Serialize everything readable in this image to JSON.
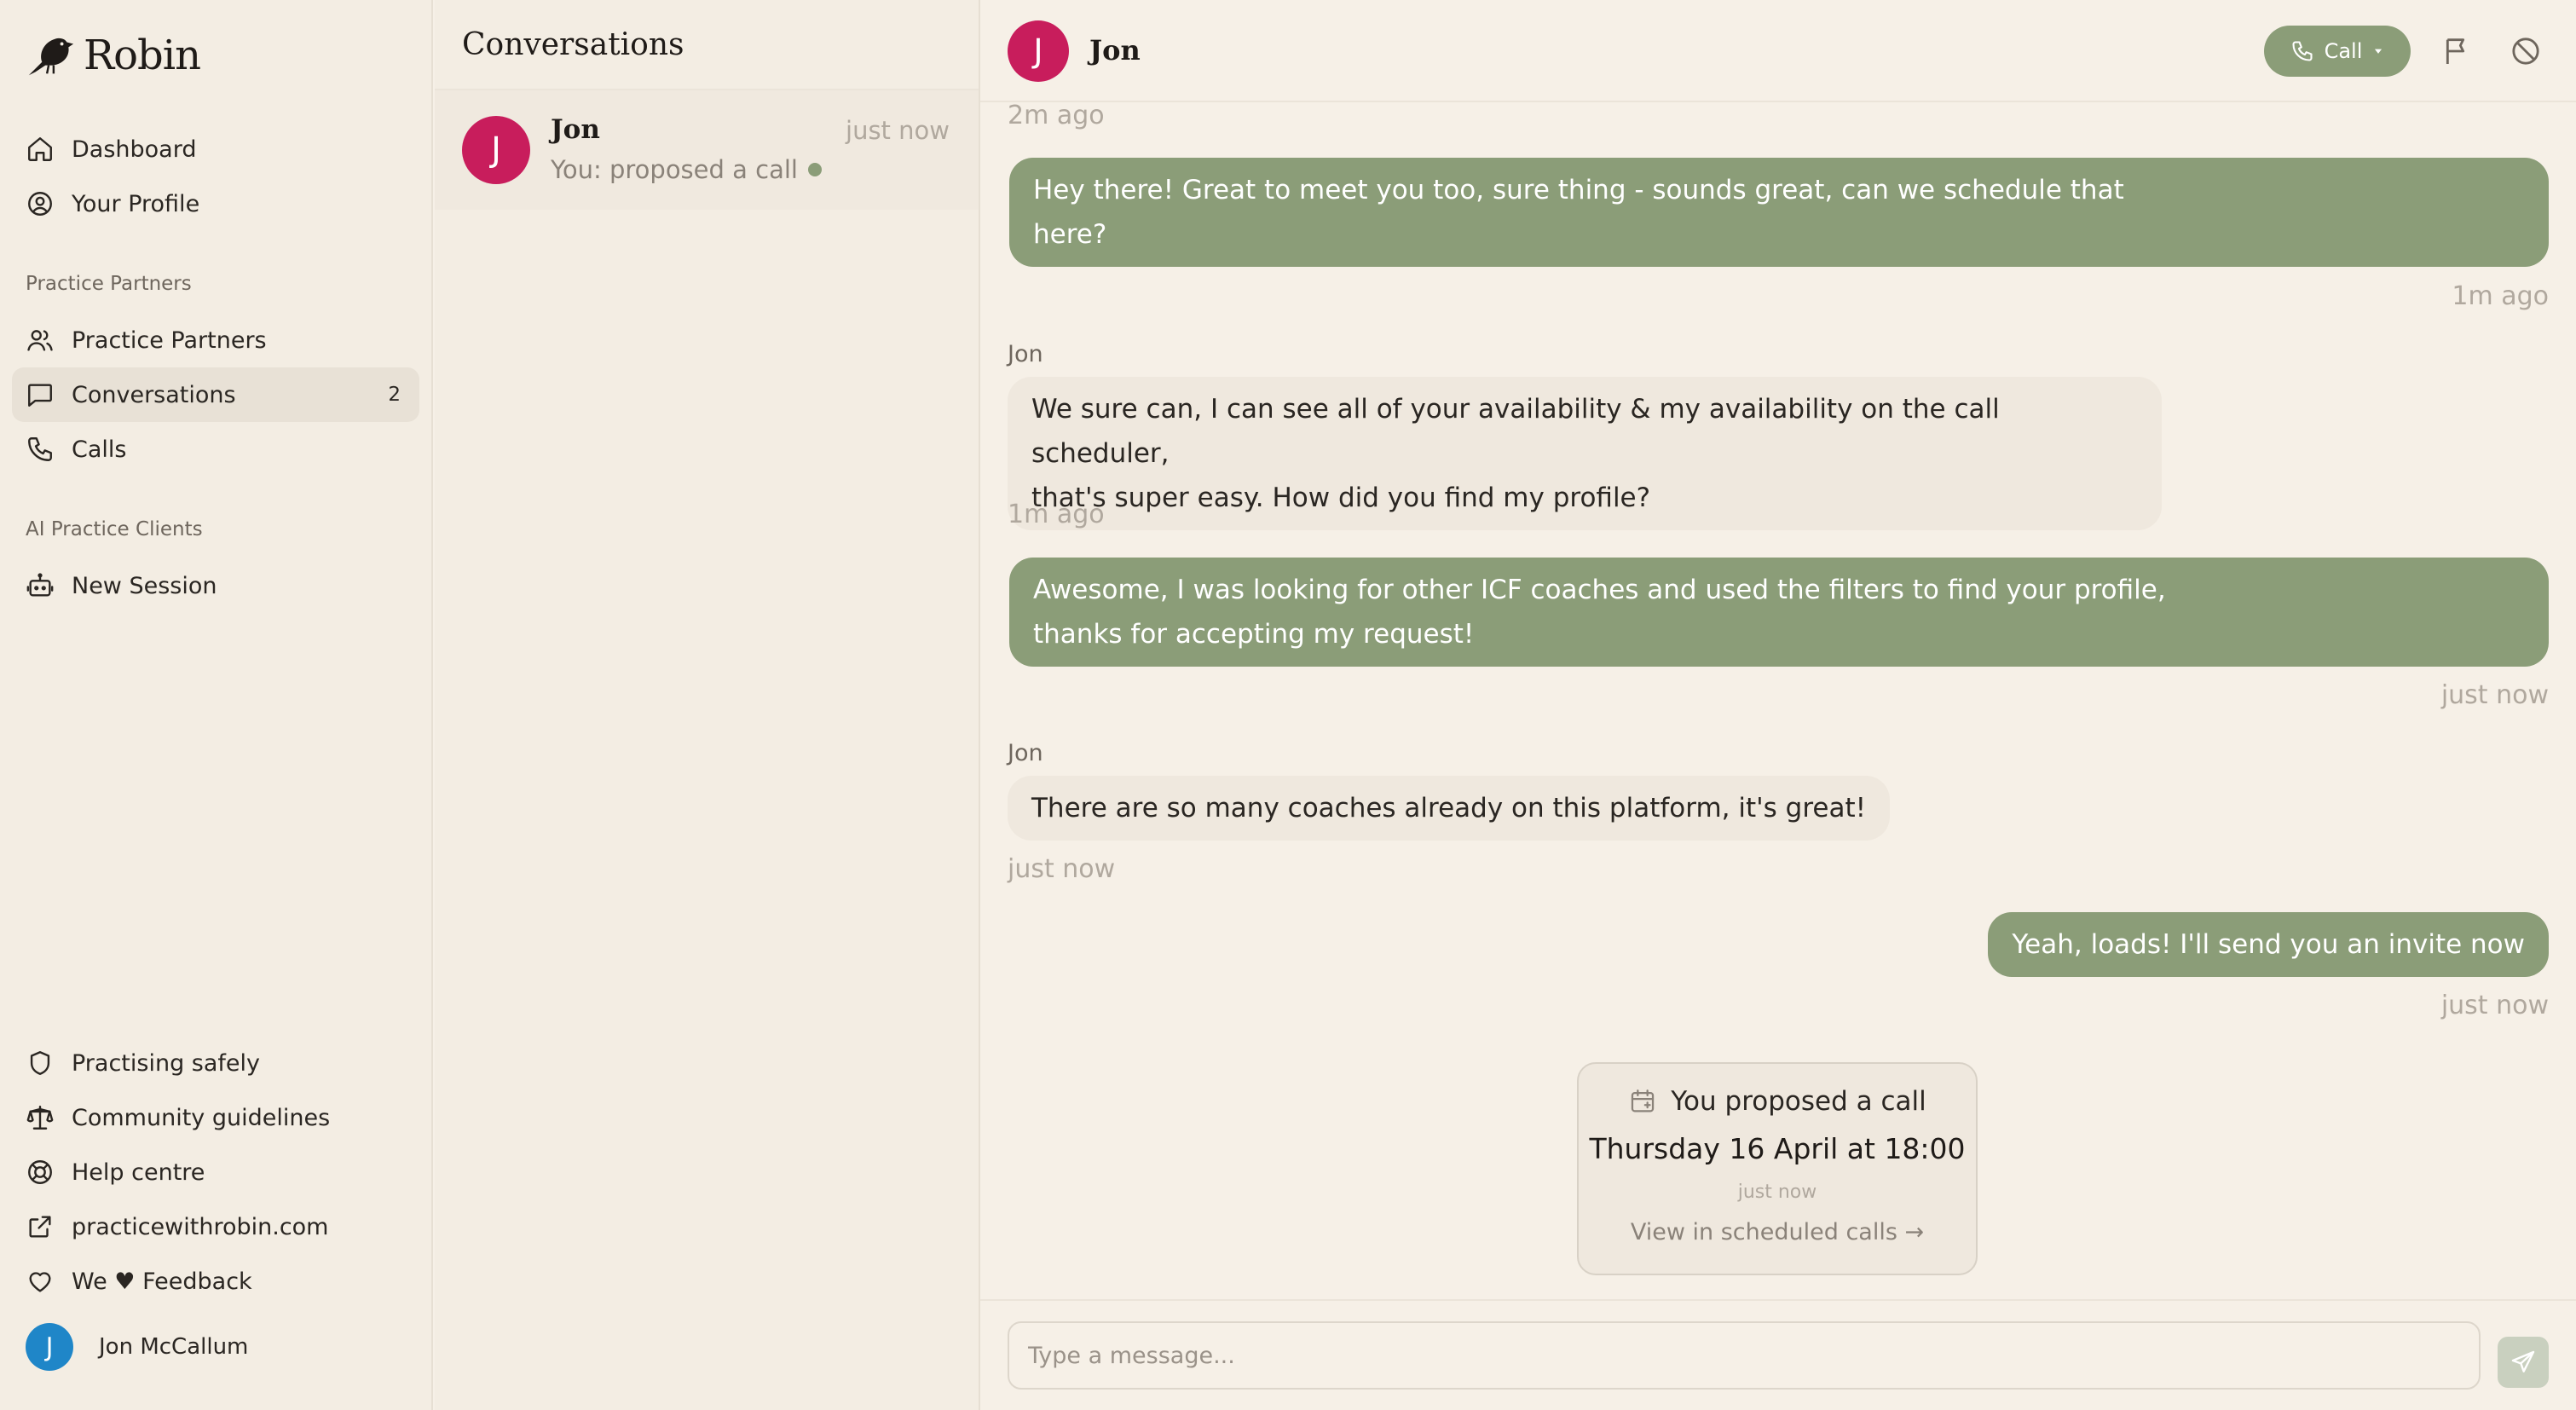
{
  "app": {
    "name": "Robin"
  },
  "sidebar": {
    "main_items": [
      {
        "label": "Dashboard",
        "icon": "home-icon"
      },
      {
        "label": "Your Profile",
        "icon": "user-circle-icon"
      }
    ],
    "section_partners": "Practice Partners",
    "partner_items": [
      {
        "label": "Practice Partners",
        "icon": "users-icon"
      },
      {
        "label": "Conversations",
        "icon": "message-square-icon",
        "count": "2",
        "active": true
      },
      {
        "label": "Calls",
        "icon": "phone-icon"
      }
    ],
    "section_ai": "AI Practice Clients",
    "ai_items": [
      {
        "label": "New Session",
        "icon": "bot-icon"
      }
    ],
    "footer_items": [
      {
        "label": "Practising safely",
        "icon": "shield-icon"
      },
      {
        "label": "Community guidelines",
        "icon": "scale-icon"
      },
      {
        "label": "Help centre",
        "icon": "lifebuoy-icon"
      },
      {
        "label": "practicewithrobin.com",
        "icon": "external-link-icon"
      },
      {
        "label": "We ♥ Feedback",
        "icon": "heart-icon"
      }
    ],
    "user": {
      "initial": "J",
      "name": "Jon McCallum",
      "avatar_color": "#1f86c8"
    }
  },
  "conversations": {
    "title": "Conversations",
    "items": [
      {
        "initial": "J",
        "name": "Jon",
        "time": "just now",
        "preview": "You: proposed a call",
        "unread": true,
        "avatar_color": "#c81d5c"
      }
    ]
  },
  "chat": {
    "contact": {
      "initial": "J",
      "name": "Jon"
    },
    "call_button": "Call",
    "header_icons": [
      "flag-icon",
      "block-icon"
    ],
    "top_timestamp": "2m ago",
    "messages": [
      {
        "from": "me",
        "lines": [
          "Hey there! Great to meet you too, sure thing - sounds great, can we schedule that",
          "here?"
        ],
        "time": "1m ago"
      },
      {
        "from": "them",
        "sender": "Jon",
        "lines": [
          "We sure can, I can see all of your availability & my availability on the call scheduler,",
          "that's super easy. How did you find my profile?"
        ],
        "time": "1m ago"
      },
      {
        "from": "me",
        "lines": [
          "Awesome, I was looking for other ICF coaches and used the filters to find your profile,",
          "thanks for accepting my request!"
        ],
        "time": "just now"
      },
      {
        "from": "them",
        "sender": "Jon",
        "lines": [
          "There are so many coaches already on this platform, it's great!"
        ],
        "time": "just now"
      },
      {
        "from": "me",
        "lines": [
          "Yeah, loads! I'll send you an invite now"
        ],
        "time": "just now"
      }
    ],
    "proposal": {
      "title": "You proposed a call",
      "when": "Thursday 16 April at 18:00",
      "time": "just now",
      "link": "View in scheduled calls →"
    },
    "composer": {
      "placeholder": "Type a message...",
      "value": ""
    }
  },
  "colors": {
    "accent": "#8b9d78",
    "contact_avatar": "#c81d5c",
    "background": "#f6f0e7",
    "sidebar": "#f3ede3"
  }
}
